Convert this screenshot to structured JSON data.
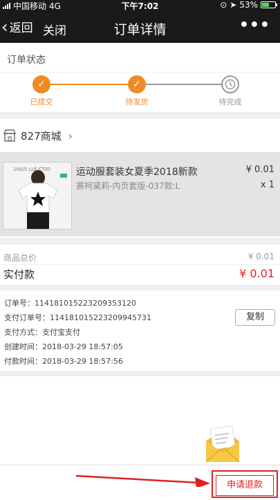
{
  "statusbar": {
    "carrier": "中国移动",
    "network": "4G",
    "time": "下午7:02",
    "battery": "53%",
    "battery_level": 0.53
  },
  "nav": {
    "back_label": "返回",
    "close_label": "关闭",
    "title": "订单详情",
    "more_label": "•••"
  },
  "order_status": {
    "title": "订单状态",
    "steps": [
      {
        "label": "已提交",
        "state": "done"
      },
      {
        "label": "待发货",
        "state": "done"
      },
      {
        "label": "待完成",
        "state": "pending"
      }
    ],
    "accent": "#f08a24"
  },
  "shop": {
    "name": "827商城",
    "icon": "store-icon"
  },
  "product": {
    "title": "运动服套装女夏季2018新款",
    "variant": "赛柯黛莉-内页套版-037款:L",
    "price": "¥ 0.01",
    "qty": "x 1",
    "thumb_text": "10S/S  LLE  CTIO"
  },
  "totals": {
    "goods_label": "商品总价",
    "goods_value": "¥ 0.01",
    "paid_label": "实付款",
    "paid_value": "¥ 0.01",
    "paid_color": "#e02020"
  },
  "info": {
    "order_no": "订单号：114181015223209353120",
    "pay_order_no": "支付订单号：114181015223209945731",
    "pay_method": "支付方式：支付宝支付",
    "created": "创建时间：2018-03-29 18:57:05",
    "paid_time": "付款时间：2018-03-29 18:57:56",
    "copy_label": "复制"
  },
  "bottom": {
    "refund_label": "申请退款"
  }
}
